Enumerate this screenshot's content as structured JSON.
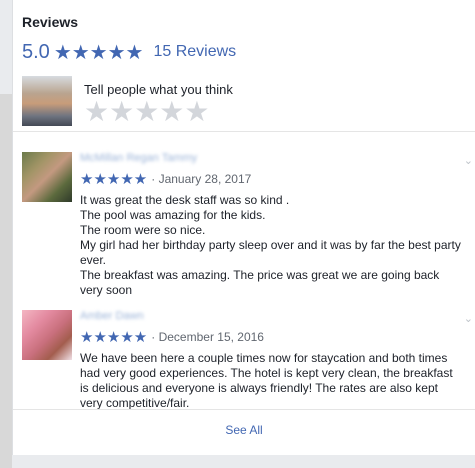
{
  "reviews_panel": {
    "title": "Reviews",
    "average_rating": "5.0",
    "rating_stars": "★★★★★",
    "reviews_count": "15 Reviews",
    "compose_prompt": "Tell people what you think",
    "compose_stars": "★★★★★",
    "see_all": "See All"
  },
  "reviews": [
    {
      "name": "McMillan Regan Tammy",
      "stars": "★★★★★",
      "date": "· January 28, 2017",
      "text": "It was great the desk staff was so kind .\nThe pool was amazing for the kids.\nThe room were so nice.\nMy girl had her birthday party sleep over and it was by far the best party ever.\nThe breakfast was amazing. The price was great we are going back very soon"
    },
    {
      "name": "Amber Dawn",
      "stars": "★★★★★",
      "date": "· December 15, 2016",
      "text": "We have been here a couple times now for staycation and both times had very good experiences. The hotel is kept very clean, the breakfast is delicious and everyone is always friendly! The rates are also kept very competitive/fair."
    }
  ],
  "icons": {
    "expand": "chevron-down-icon",
    "star": "star-icon"
  },
  "colors": {
    "accent": "#4267b2",
    "empty_star": "#d3d6db",
    "text": "#1d2129"
  }
}
